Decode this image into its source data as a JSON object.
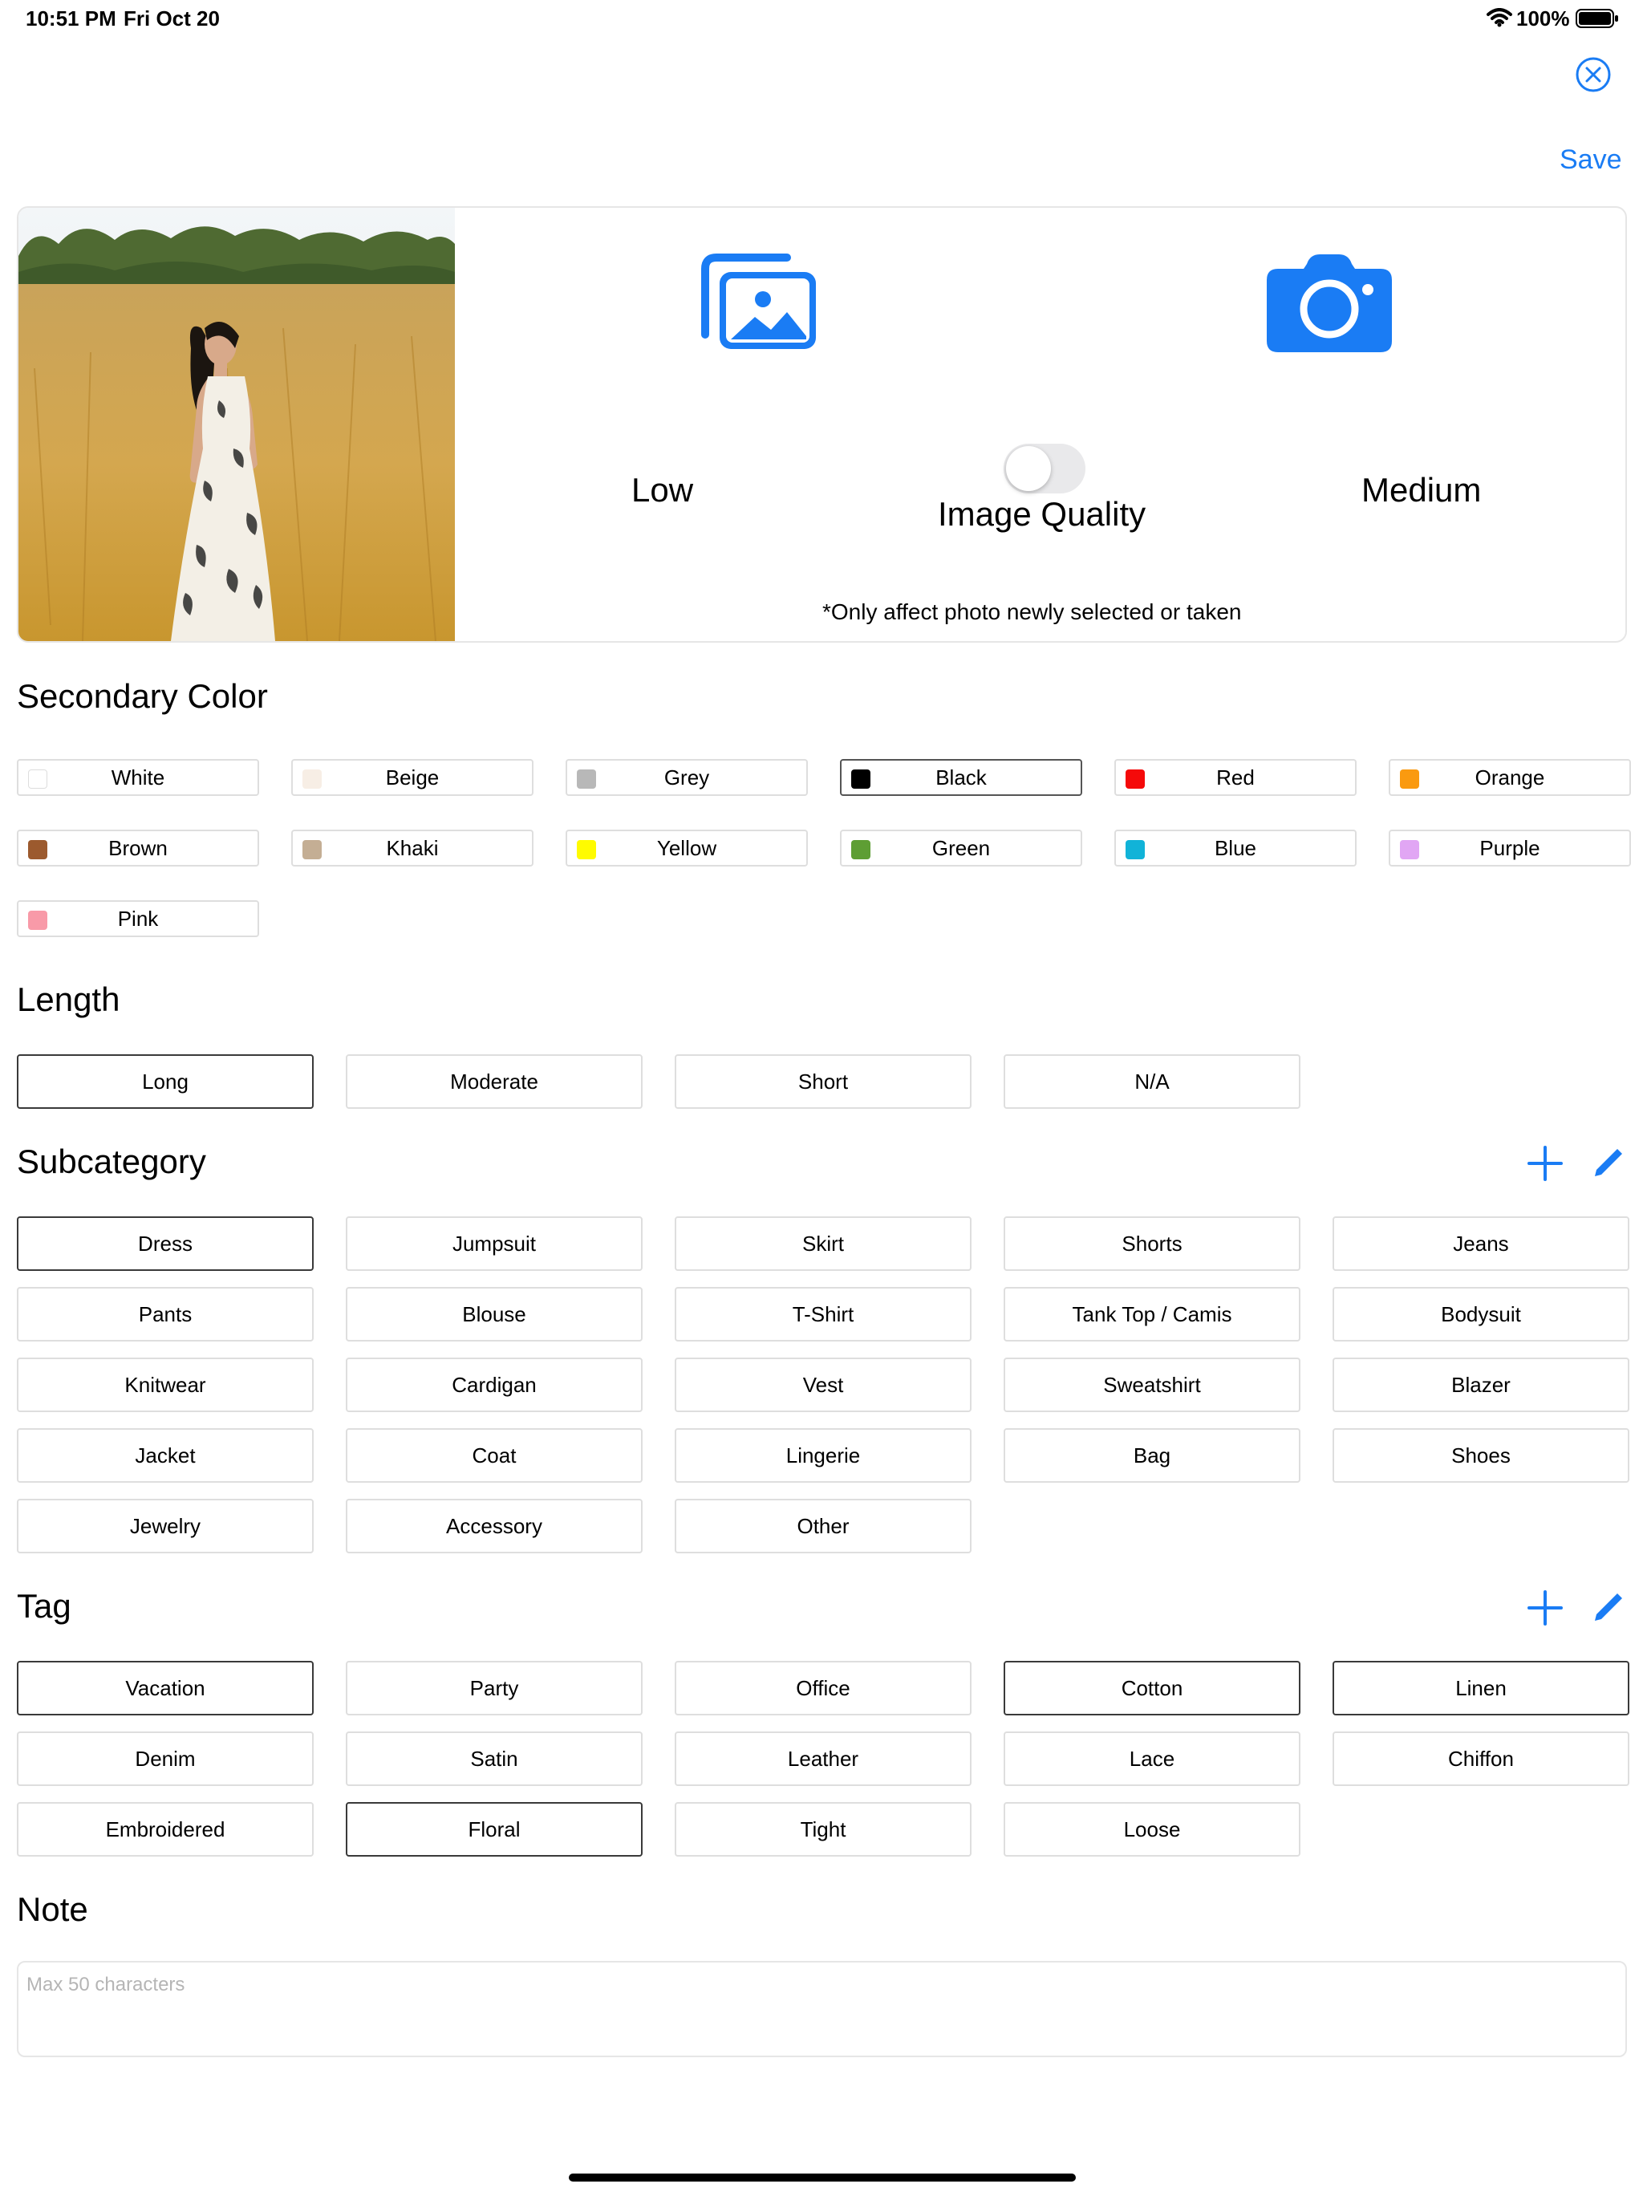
{
  "status_bar": {
    "time": "10:51 PM",
    "date": "Fri Oct 20",
    "battery": "100%"
  },
  "header": {
    "save_label": "Save"
  },
  "image_panel": {
    "low_label": "Low",
    "quality_label": "Image Quality",
    "medium_label": "Medium",
    "quality_toggle_on": false,
    "note_text": "*Only affect photo newly selected or taken"
  },
  "secondary_color": {
    "title": "Secondary Color",
    "items": [
      {
        "label": "White",
        "color": "#ffffff",
        "selected": false
      },
      {
        "label": "Beige",
        "color": "#f7eee5",
        "selected": false
      },
      {
        "label": "Grey",
        "color": "#b8b8b8",
        "selected": false
      },
      {
        "label": "Black",
        "color": "#000000",
        "selected": true
      },
      {
        "label": "Red",
        "color": "#f50a0a",
        "selected": false
      },
      {
        "label": "Orange",
        "color": "#fa9a10",
        "selected": false
      },
      {
        "label": "Brown",
        "color": "#9c5a2e",
        "selected": false
      },
      {
        "label": "Khaki",
        "color": "#c4ae94",
        "selected": false
      },
      {
        "label": "Yellow",
        "color": "#fffb00",
        "selected": false
      },
      {
        "label": "Green",
        "color": "#5e9e34",
        "selected": false
      },
      {
        "label": "Blue",
        "color": "#11b3d8",
        "selected": false
      },
      {
        "label": "Purple",
        "color": "#e1a6f4",
        "selected": false
      },
      {
        "label": "Pink",
        "color": "#f89aa8",
        "selected": false
      }
    ]
  },
  "length": {
    "title": "Length",
    "items": [
      {
        "label": "Long",
        "selected": true
      },
      {
        "label": "Moderate",
        "selected": false
      },
      {
        "label": "Short",
        "selected": false
      },
      {
        "label": "N/A",
        "selected": false
      }
    ]
  },
  "subcategory": {
    "title": "Subcategory",
    "items": [
      {
        "label": "Dress",
        "selected": true
      },
      {
        "label": "Jumpsuit",
        "selected": false
      },
      {
        "label": "Skirt",
        "selected": false
      },
      {
        "label": "Shorts",
        "selected": false
      },
      {
        "label": "Jeans",
        "selected": false
      },
      {
        "label": "Pants",
        "selected": false
      },
      {
        "label": "Blouse",
        "selected": false
      },
      {
        "label": "T-Shirt",
        "selected": false
      },
      {
        "label": "Tank Top / Camis",
        "selected": false
      },
      {
        "label": "Bodysuit",
        "selected": false
      },
      {
        "label": "Knitwear",
        "selected": false
      },
      {
        "label": "Cardigan",
        "selected": false
      },
      {
        "label": "Vest",
        "selected": false
      },
      {
        "label": "Sweatshirt",
        "selected": false
      },
      {
        "label": "Blazer",
        "selected": false
      },
      {
        "label": "Jacket",
        "selected": false
      },
      {
        "label": "Coat",
        "selected": false
      },
      {
        "label": "Lingerie",
        "selected": false
      },
      {
        "label": "Bag",
        "selected": false
      },
      {
        "label": "Shoes",
        "selected": false
      },
      {
        "label": "Jewelry",
        "selected": false
      },
      {
        "label": "Accessory",
        "selected": false
      },
      {
        "label": "Other",
        "selected": false
      }
    ]
  },
  "tag": {
    "title": "Tag",
    "items": [
      {
        "label": "Vacation",
        "selected": true
      },
      {
        "label": "Party",
        "selected": false
      },
      {
        "label": "Office",
        "selected": false
      },
      {
        "label": "Cotton",
        "selected": true
      },
      {
        "label": "Linen",
        "selected": true
      },
      {
        "label": "Denim",
        "selected": false
      },
      {
        "label": "Satin",
        "selected": false
      },
      {
        "label": "Leather",
        "selected": false
      },
      {
        "label": "Lace",
        "selected": false
      },
      {
        "label": "Chiffon",
        "selected": false
      },
      {
        "label": "Embroidered",
        "selected": false
      },
      {
        "label": "Floral",
        "selected": true
      },
      {
        "label": "Tight",
        "selected": false
      },
      {
        "label": "Loose",
        "selected": false
      }
    ]
  },
  "note": {
    "title": "Note",
    "placeholder": "Max 50 characters",
    "value": ""
  },
  "icons": {
    "accent": "#1a7cf4",
    "close": "close-circle-icon",
    "gallery": "photo-library-icon",
    "camera": "camera-icon",
    "add": "plus-icon",
    "edit": "pencil-icon"
  }
}
